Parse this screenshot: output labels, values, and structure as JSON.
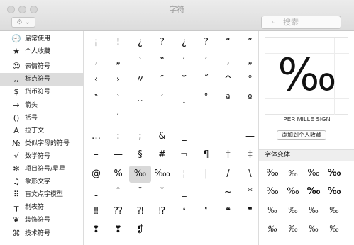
{
  "window": {
    "title": "字符"
  },
  "toolbar": {
    "gear_label": "⚙ ⌄",
    "search_placeholder": "搜索"
  },
  "sidebar": {
    "items": [
      {
        "icon": "🕘",
        "label": "最常使用"
      },
      {
        "icon": "★",
        "label": "个人收藏"
      },
      {
        "icon": "☺",
        "label": "表情符号"
      },
      {
        "icon": ",,",
        "label": "标点符号"
      },
      {
        "icon": "$",
        "label": "货币符号"
      },
      {
        "icon": "→",
        "label": "箭头"
      },
      {
        "icon": "()",
        "label": "括号"
      },
      {
        "icon": "A",
        "label": "拉丁文"
      },
      {
        "icon": "№",
        "label": "类似字母的符号"
      },
      {
        "icon": "√",
        "label": "数学符号"
      },
      {
        "icon": "✻",
        "label": "项目符号/星星"
      },
      {
        "icon": "♫",
        "label": "象形文字"
      },
      {
        "icon": "⠿",
        "label": "盲文点字模型"
      },
      {
        "icon": "┳",
        "label": "制表符"
      },
      {
        "icon": "❦",
        "label": "装饰符号"
      },
      {
        "icon": "⌘",
        "label": "技术符号"
      }
    ],
    "selected_index": 3
  },
  "grid": {
    "rows": [
      [
        "¡",
        "!",
        "¿",
        "?",
        "¿",
        "?",
        "“",
        "”"
      ],
      [
        "‚",
        "„",
        "‛",
        "‟",
        "‘",
        "’",
        "‚",
        "„"
      ],
      [
        "‹",
        "›",
        "〃",
        "″",
        "‴",
        "˝",
        "^",
        "°"
      ],
      [
        "‶",
        "‵",
        "‥",
        "′",
        "‸",
        "˚",
        "ª",
        "º"
      ],
      [
        "ˌ",
        "‘",
        "",
        "",
        "",
        "",
        "",
        ""
      ],
      [
        "…",
        ":",
        ";",
        "&",
        "_",
        "",
        "",
        "—"
      ],
      [
        "–",
        "—",
        "§",
        "#",
        "¬",
        "¶",
        "†",
        "‡"
      ],
      [
        "@",
        "%",
        "‰",
        "‱",
        "¦",
        "|",
        "/",
        "\\"
      ],
      [
        "ˍ",
        "ˆ",
        "ˇ",
        "˘",
        "‗",
        "‾",
        "~",
        "*"
      ],
      [
        "‼",
        "⁇",
        "⁈",
        "⁉",
        "❛",
        "❜",
        "❝",
        "❞"
      ],
      [
        "❢",
        "❣",
        "❡",
        "",
        "",
        "",
        "",
        ""
      ]
    ],
    "selected": {
      "row": 7,
      "col": 2
    }
  },
  "detail": {
    "glyph": "‰",
    "char_name": "PER MILLE SIGN",
    "add_favorite_label": "添加到个人收藏",
    "variants_header": "字体变体",
    "variants": [
      [
        "‰",
        "‰",
        "‰",
        "‰"
      ],
      [
        "‰",
        "‰",
        "‰",
        "‰"
      ],
      [
        "‰",
        "‰",
        "‰",
        "‰"
      ],
      [
        "‰",
        "‰",
        "‰",
        "‰"
      ]
    ]
  }
}
